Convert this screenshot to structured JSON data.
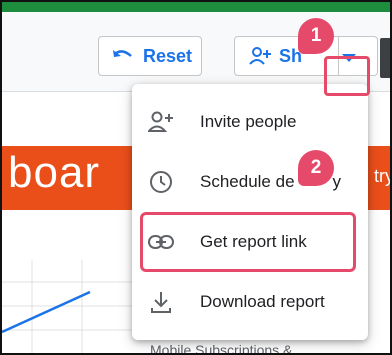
{
  "toolbar": {
    "reset_label": "Reset",
    "share_label": "Sh"
  },
  "banner": {
    "title_fragment": "boar",
    "right_fragment": "try"
  },
  "share_menu": {
    "items": [
      {
        "label": "Invite people",
        "icon": "person-add-icon"
      },
      {
        "label": "Schedule de",
        "label_tail": "y",
        "icon": "clock-icon"
      },
      {
        "label": "Get report link",
        "icon": "link-icon"
      },
      {
        "label": "Download report",
        "icon": "download-icon"
      }
    ]
  },
  "callouts": {
    "first": "1",
    "second": "2"
  },
  "footer": {
    "text": "Mobile Subscriptions &"
  },
  "colors": {
    "accent": "#1a73e8",
    "banner": "#ea4f1a",
    "highlight": "#e64a6a",
    "top_strip": "#1e8e3e"
  }
}
